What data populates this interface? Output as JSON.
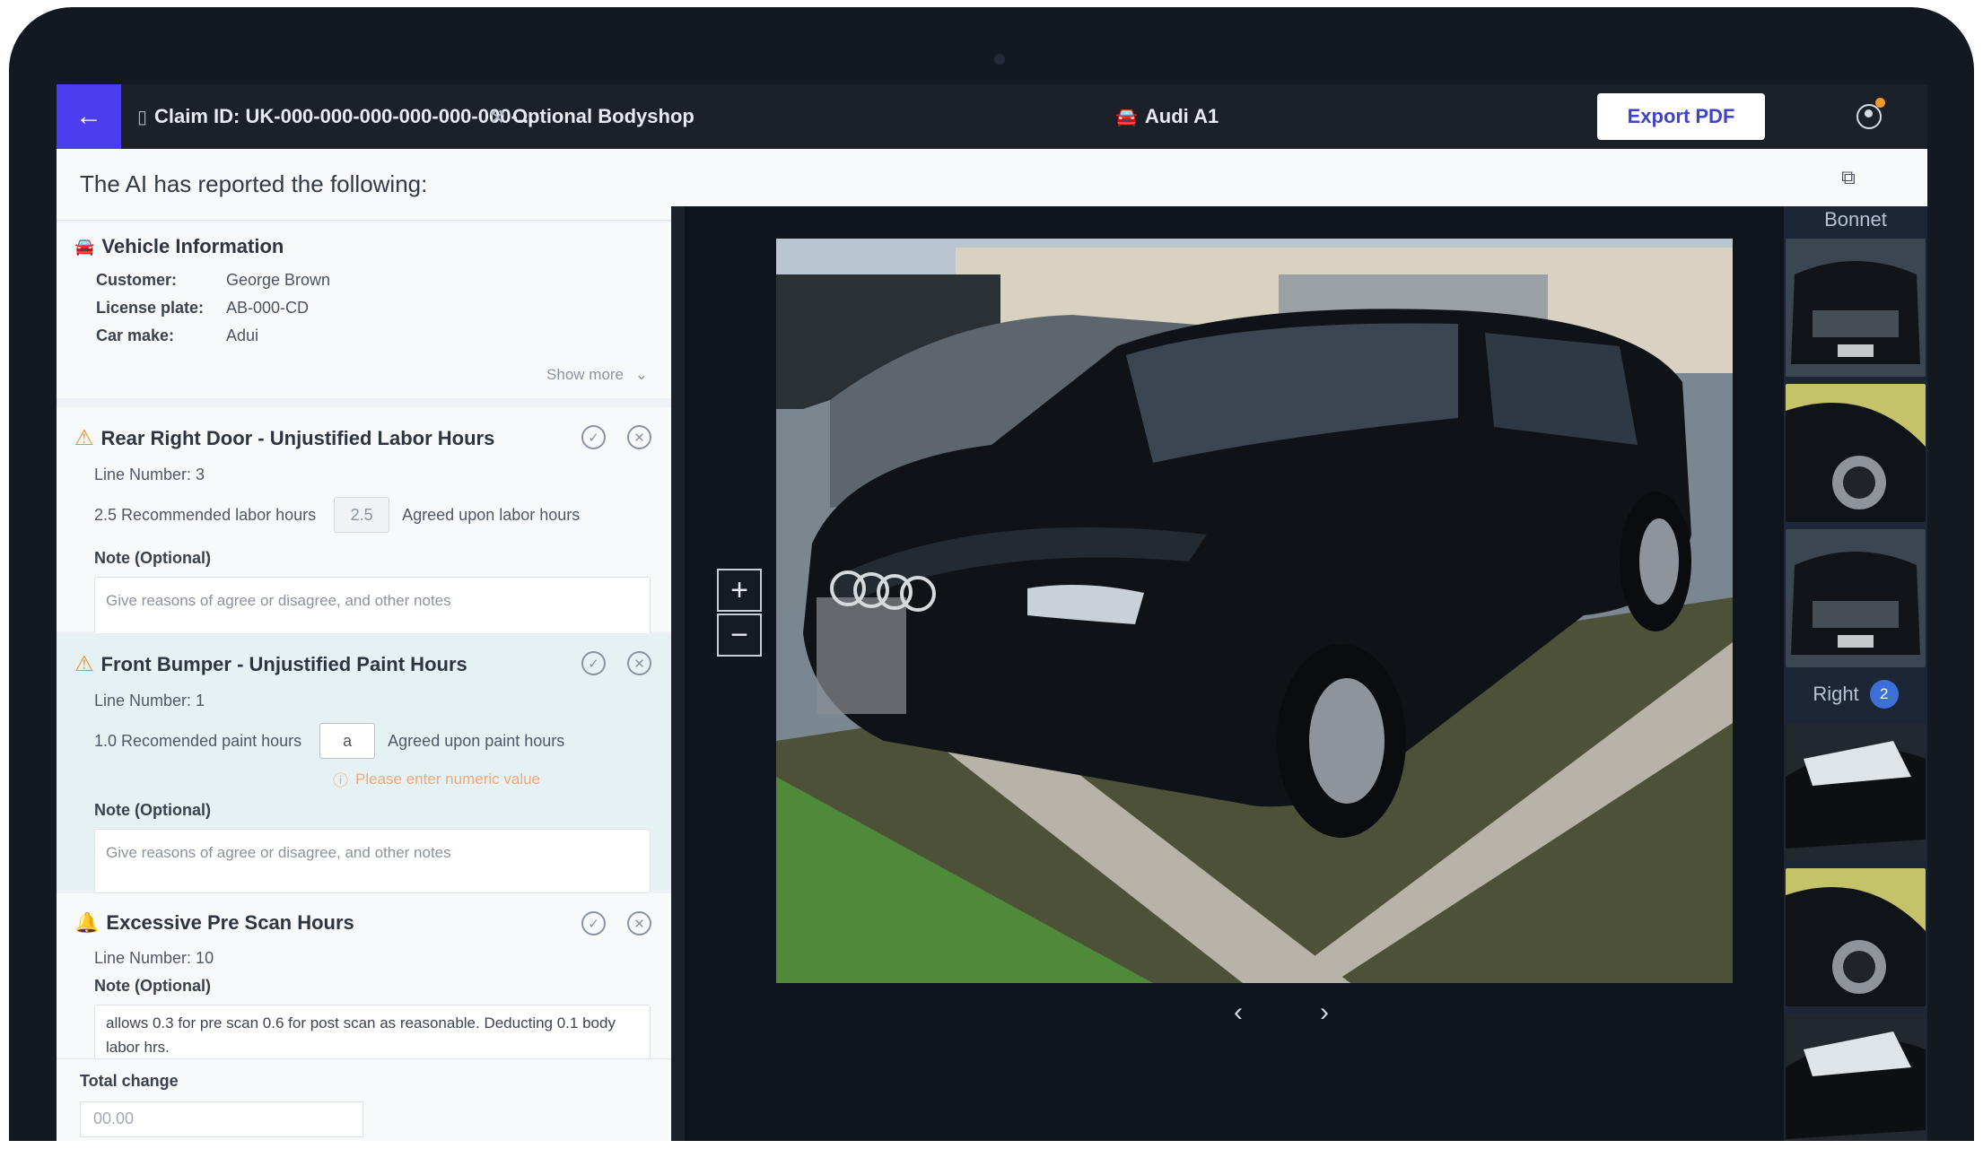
{
  "header": {
    "claim_id": "Claim ID: UK-000-000-000-000-000-000-...",
    "bodyshop": "Optional Bodyshop",
    "car": "Audi A1",
    "export_label": "Export PDF"
  },
  "left": {
    "title": "The AI has reported the following:",
    "vehicle": {
      "title": "Vehicle Information",
      "rows": [
        {
          "key": "Customer:",
          "value": "George Brown"
        },
        {
          "key": "License plate:",
          "value": "AB-000-CD"
        },
        {
          "key": "Car make:",
          "value": "Adui"
        }
      ],
      "show_more": "Show more"
    },
    "cards": [
      {
        "title": "Rear Right Door - Unjustified Labor Hours",
        "line": "Line Number: 3",
        "recommended": "2.5 Recommended labor hours",
        "input_value": "2.5",
        "agreed": "Agreed upon labor hours",
        "note_label": "Note (Optional)",
        "note_placeholder": "Give reasons of agree or disagree, and other notes"
      },
      {
        "title": "Front Bumper - Unjustified Paint Hours",
        "line": "Line Number: 1",
        "recommended": "1.0 Recomended paint hours",
        "input_value": "a",
        "agreed": "Agreed upon paint hours",
        "error": "Please enter numeric value",
        "note_label": "Note (Optional)",
        "note_placeholder": "Give reasons of agree or disagree, and other notes"
      },
      {
        "title": "Excessive Pre Scan Hours",
        "line": "Line Number: 10",
        "note_label": "Note (Optional)",
        "note_text": "allows 0.3 for pre scan 0.6 for post scan as reasonable. Deducting 0.1 body labor hrs."
      }
    ],
    "total": {
      "label": "Total change",
      "placeholder": "00.00"
    }
  },
  "thumbnails": {
    "group1": "Bonnet",
    "group2": "Right",
    "group2_count": "2"
  },
  "icons": {
    "back": "arrow-left-icon",
    "claim": "document-icon",
    "bodyshop": "wrench-icon",
    "car": "car-icon",
    "user": "user-circle-icon",
    "external": "external-link-icon",
    "filter": "filter-icon"
  },
  "colors": {
    "accent": "#4a3ef0",
    "warning": "#e5952e",
    "error": "#f0a77a",
    "badge": "#3d6fd8"
  }
}
